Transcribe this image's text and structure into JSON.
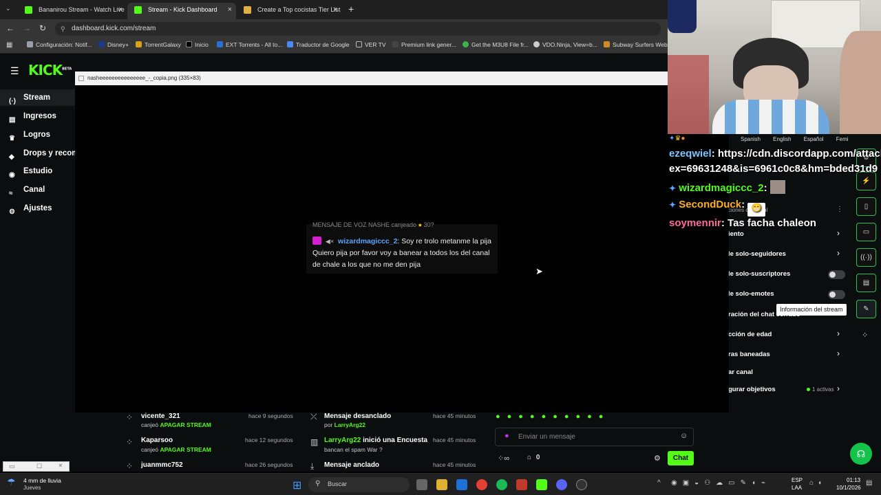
{
  "browser": {
    "tabs": [
      {
        "title": "Bananirou Stream - Watch Live",
        "fav": "#53fc18"
      },
      {
        "title": "Stream - Kick Dashboard",
        "fav": "#53fc18"
      },
      {
        "title": "Create a Top cocistas Tier List -",
        "fav": "#e0b040"
      }
    ],
    "new_tab": "+",
    "url": "dashboard.kick.com/stream",
    "bookmarks": [
      {
        "label": "Configuración: Notif...",
        "color": "#9aa0a6"
      },
      {
        "label": "Disney+",
        "color": "#1a3a8a"
      },
      {
        "label": "TorrentGalaxy",
        "color": "#d9a01a"
      },
      {
        "label": "Inicio",
        "color": "#000000"
      },
      {
        "label": "EXT Torrents - All to...",
        "color": "#2a6fd6"
      },
      {
        "label": "Traductor de Google",
        "color": "#4a8af4"
      },
      {
        "label": "VER TV",
        "color": "#888888"
      },
      {
        "label": "Premium link gener...",
        "color": "#444444"
      },
      {
        "label": "Get the M3U8 File fr...",
        "color": "#3bb54a"
      },
      {
        "label": "VDO.Ninja, View=b...",
        "color": "#cccccc"
      },
      {
        "label": "Subway Surfers Web",
        "color": "#d08a2a"
      }
    ]
  },
  "kick": {
    "logo": "KICK",
    "logo_badge": "BETA",
    "nav": [
      {
        "label": "Stream",
        "icon": "(·)"
      },
      {
        "label": "Ingresos",
        "icon": "▤"
      },
      {
        "label": "Logros",
        "icon": "♛"
      },
      {
        "label": "Drops y recom",
        "icon": "◆"
      },
      {
        "label": "Estudio",
        "icon": "◉"
      },
      {
        "label": "Canal",
        "icon": "≈"
      },
      {
        "label": "Ajustes",
        "icon": "⚙"
      }
    ]
  },
  "viewer": {
    "title": "nasheeeeeeeeeeeeeee_-_copia.png (335×83)",
    "cut_line": "MENSAJE DE VOZ NASHE canjeado",
    "username": "wizardmagiccc_2",
    "message": ": Soy re trolo metanme la pija Quiero pija por favor voy a banear a todos los del canal de chale a los que no me den pija"
  },
  "settings": {
    "header": "ciones del canal",
    "rows": [
      {
        "label": "iento",
        "control": "chevron"
      },
      {
        "label": "le solo-seguidores",
        "control": "chevron"
      },
      {
        "label": "le solo-suscriptores",
        "control": "toggle"
      },
      {
        "label": "le solo-emotes",
        "control": "toggle"
      },
      {
        "label": "ración del chat cerrado",
        "control": "none"
      },
      {
        "label": "cción de edad",
        "control": "chevron"
      },
      {
        "label": "ras baneadas",
        "control": "chevron"
      },
      {
        "label": "ar canal",
        "control": "none"
      },
      {
        "label": "gurar objetivos",
        "control": "chevron"
      }
    ],
    "goals_active": "1 activas",
    "tooltip": "Información del stream"
  },
  "overlay_chat": {
    "languages": [
      "Spanish",
      "English",
      "Español",
      "Femi"
    ],
    "messages": [
      {
        "user": "ezeqwiel",
        "color": "#7fc6ff",
        "text": ": https://cdn.discordapp.com/attach",
        "line2": "ex=69631248&is=6961c0c8&hm=bded31d9"
      },
      {
        "user": "wizardmagiccc_2",
        "color": "#53fc18",
        "text": ":",
        "line2": ""
      },
      {
        "user": "SecondDuck",
        "color": "#ffb020",
        "text": ":",
        "line2": ""
      },
      {
        "user": "soymennir",
        "color": "#ff6a9a",
        "text": ": Tas facha chaleon",
        "line2": ""
      }
    ]
  },
  "activity": [
    {
      "user": "vicente_321",
      "action": "canjeó",
      "reward": "APAGAR STREAM",
      "time": "hace 9 segundos"
    },
    {
      "user": "Kaparsoo",
      "action": "canjeó",
      "reward": "APAGAR STREAM",
      "time": "hace 12 segundos"
    },
    {
      "user": "juanmmc752",
      "action": "",
      "reward": "",
      "time": "hace 26 segundos"
    }
  ],
  "mod_log": [
    {
      "title": "Mensaje desanclado",
      "sub_prefix": "por",
      "sub_user": "LarryArg22",
      "time": "hace 45 minutos"
    },
    {
      "title_user": "LarryArg22",
      "title": " inició una Encuesta",
      "sub_prefix": "bancan el spam War ?",
      "sub_user": "",
      "time": "hace 45 minutos"
    },
    {
      "title": "Mensaje anclado",
      "sub_prefix": "",
      "sub_user": "",
      "time": "hace 45 minutos"
    }
  ],
  "chat_input": {
    "placeholder": "Enviar un mensaje",
    "points": "0",
    "chat_button": "Chat"
  },
  "taskbar": {
    "weather": "4 mm de lluvia",
    "weather_day": "Jueves",
    "search": "Buscar",
    "lang": "ESP",
    "lang2": "LAA",
    "time": "01:13",
    "date": "10/1/2026"
  }
}
